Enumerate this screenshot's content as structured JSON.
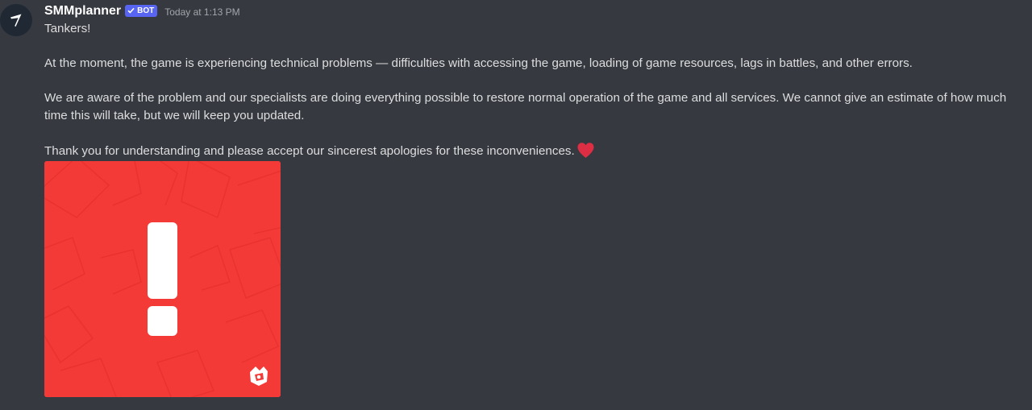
{
  "message": {
    "author": {
      "name": "SMMplanner",
      "tag": "BOT",
      "avatar_icon": "arrow-logo-icon"
    },
    "timestamp": "Today at 1:13 PM",
    "paragraphs": [
      "Tankers!",
      "At the moment, the game is experiencing technical problems — difficulties with accessing the game, loading of game resources, lags in battles, and other errors.",
      "We are aware of the problem and our specialists are doing everything possible to restore normal operation of the game and all services. We cannot give an estimate of how much time this will take, but we will keep you updated.",
      "Thank you for understanding and please accept our sincerest apologies for these inconveniences."
    ],
    "emoji": "red-heart-icon",
    "attachment": {
      "type": "image",
      "icon": "exclamation-mark-icon",
      "watermark_icon": "game-logo-icon",
      "background_color": "#f33a37"
    }
  },
  "colors": {
    "background": "#36393f",
    "text": "#dcddde",
    "username": "#ffffff",
    "timestamp": "#a3a6aa",
    "bot_tag": "#5865f2",
    "heart": "#dd2e44"
  }
}
